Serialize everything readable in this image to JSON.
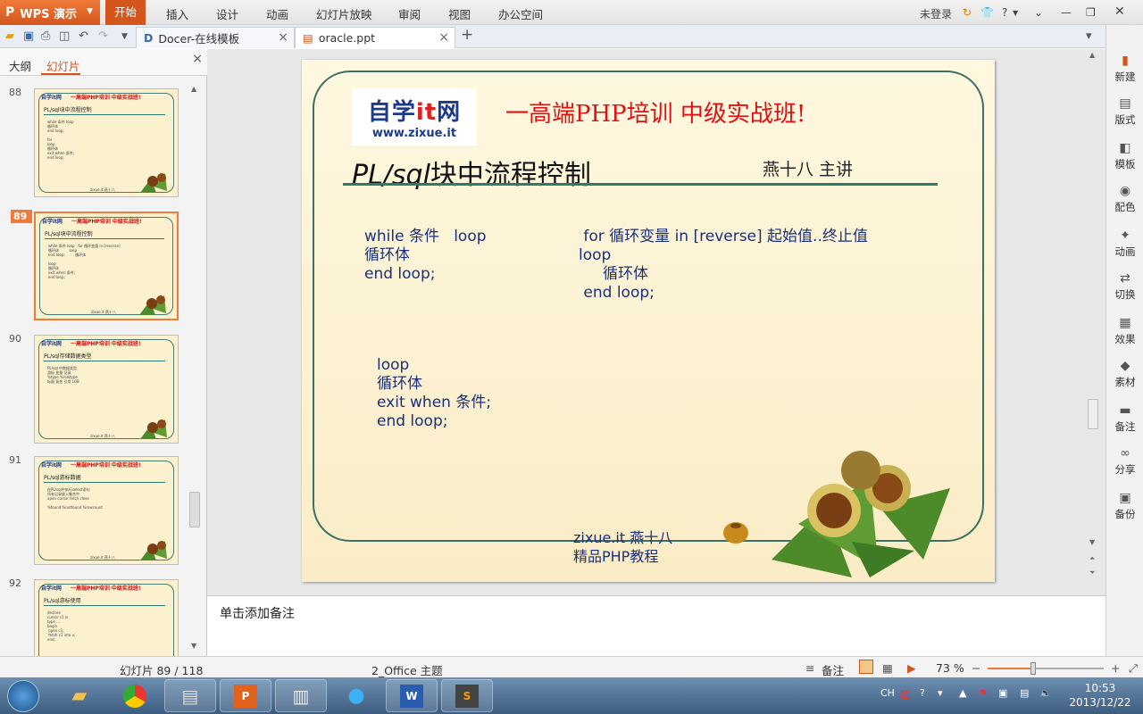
{
  "menubar": {
    "app_name": "WPS 演示",
    "items": [
      "开始",
      "插入",
      "设计",
      "动画",
      "幻灯片放映",
      "审阅",
      "视图",
      "办公空间"
    ],
    "right": {
      "login": "未登录",
      "help": "?"
    }
  },
  "tabs": [
    {
      "label": "Docer-在线模板",
      "icon": "docer-icon"
    },
    {
      "label": "oracle.ppt",
      "icon": "ppt-file-icon"
    }
  ],
  "left_panel": {
    "tabs": [
      "大纲",
      "幻灯片"
    ],
    "active_tab": "幻灯片",
    "slides": [
      {
        "num": "88",
        "title": "PL/sql块中流程控制"
      },
      {
        "num": "89",
        "title": "PL/sql块中流程控制",
        "selected": true
      },
      {
        "num": "90",
        "title": "PL/sql存储数据类型"
      },
      {
        "num": "91",
        "title": "PL/sql游标数据"
      },
      {
        "num": "92",
        "title": "PL/sql游标使用"
      }
    ],
    "thumb_common": {
      "logo": "自学it网",
      "banner": "一高端PHP培训 中级实战班!",
      "presenter": "燕十八 主讲",
      "footer": "zixue.it 燕十八"
    }
  },
  "slide": {
    "logo_line1_a": "自学",
    "logo_line1_b": "it",
    "logo_line1_c": "网",
    "logo_line2": "www.zixue.it",
    "banner": "一高端PHP培训  中级实战班!",
    "title_italic": "PL/sql",
    "title_rest": "块中流程控制",
    "presenter": "燕十八 主讲",
    "code_while": "while 条件   loop\n循环体\nend loop;",
    "code_for": " for 循环变量 in [reverse] 起始值..终止值\nloop\n     循环体\n end loop;",
    "code_loop": "loop\n循环体\nexit when 条件;\nend loop;",
    "footer_line1": "zixue.it 燕十八",
    "footer_line2": "精品PHP教程"
  },
  "notes_placeholder": "单击添加备注",
  "right_sidebar": [
    "新建",
    "版式",
    "模板",
    "配色",
    "动画",
    "切换",
    "效果",
    "素材",
    "备注",
    "分享",
    "备份"
  ],
  "statusbar": {
    "slide_counter": "幻灯片 89 / 118",
    "theme": "2_Office 主题",
    "notes": "备注",
    "zoom": "73 %",
    "zoom_fraction": 0.73
  },
  "taskbar": {
    "lang": "CH",
    "time": "10:53",
    "date": "2013/12/22"
  },
  "colors": {
    "accent": "#d4561c",
    "slide_bg": "#fdf3d4",
    "code": "#1a2f7a",
    "banner_red": "#e01010",
    "frame": "#3e6f66"
  }
}
